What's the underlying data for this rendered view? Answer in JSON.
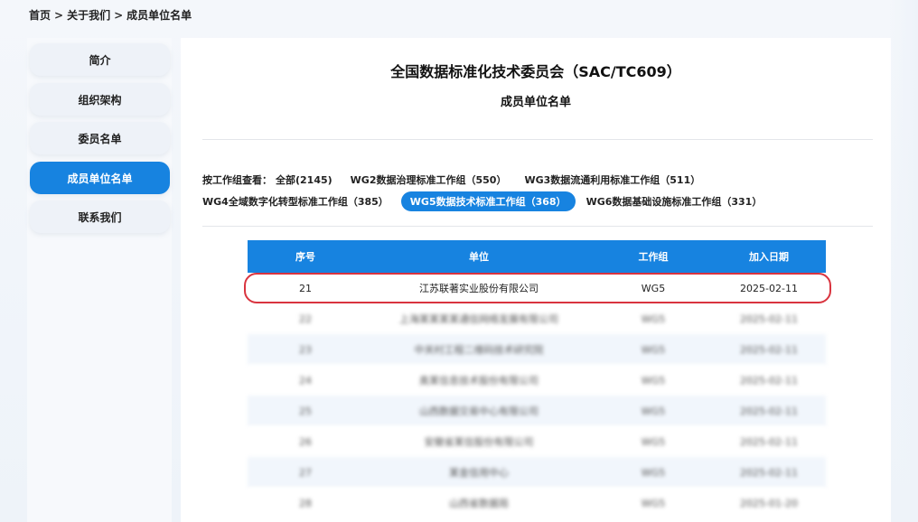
{
  "breadcrumb": {
    "home": "首页",
    "about": "关于我们",
    "current": "成员单位名单",
    "sep": ">"
  },
  "sidebar": {
    "items": [
      {
        "label": "简介"
      },
      {
        "label": "组织架构"
      },
      {
        "label": "委员名单"
      },
      {
        "label": "成员单位名单",
        "active": true
      },
      {
        "label": "联系我们"
      }
    ]
  },
  "main": {
    "title": "全国数据标准化技术委员会（SAC/TC609）",
    "subtitle": "成员单位名单"
  },
  "filters": {
    "label": "按工作组查看：",
    "chips": [
      {
        "label": "全部(2145)"
      },
      {
        "label": "WG2数据治理标准工作组（550）"
      },
      {
        "label": "WG3数据流通利用标准工作组（511）"
      },
      {
        "label": "WG4全域数字化转型标准工作组（385）"
      },
      {
        "label": "WG5数据技术标准工作组（368）",
        "active": true
      },
      {
        "label": "WG6数据基础设施标准工作组（331）"
      }
    ]
  },
  "table": {
    "headers": [
      "序号",
      "单位",
      "工作组",
      "加入日期"
    ],
    "rows": [
      [
        "21",
        "江苏联著实业股份有限公司",
        "WG5",
        "2025-02-11"
      ],
      [
        "22",
        "上海某某某某通信网络发展有限公司",
        "WG5",
        "2025-02-11"
      ],
      [
        "23",
        "中关村工程二维码技术研究院",
        "WG5",
        "2025-02-11"
      ],
      [
        "24",
        "奥某信息技术股份有限公司",
        "WG5",
        "2025-02-11"
      ],
      [
        "25",
        "山西数据交易中心有限公司",
        "WG5",
        "2025-02-11"
      ],
      [
        "26",
        "安徽省某信股份有限公司",
        "WG5",
        "2025-02-11"
      ],
      [
        "27",
        "某金信用中心",
        "WG5",
        "2025-02-11"
      ],
      [
        "28",
        "山西省数据局",
        "WG5",
        "2025-01-20"
      ]
    ]
  },
  "colors": {
    "accent": "#1783e0",
    "highlight": "#d9343f"
  }
}
